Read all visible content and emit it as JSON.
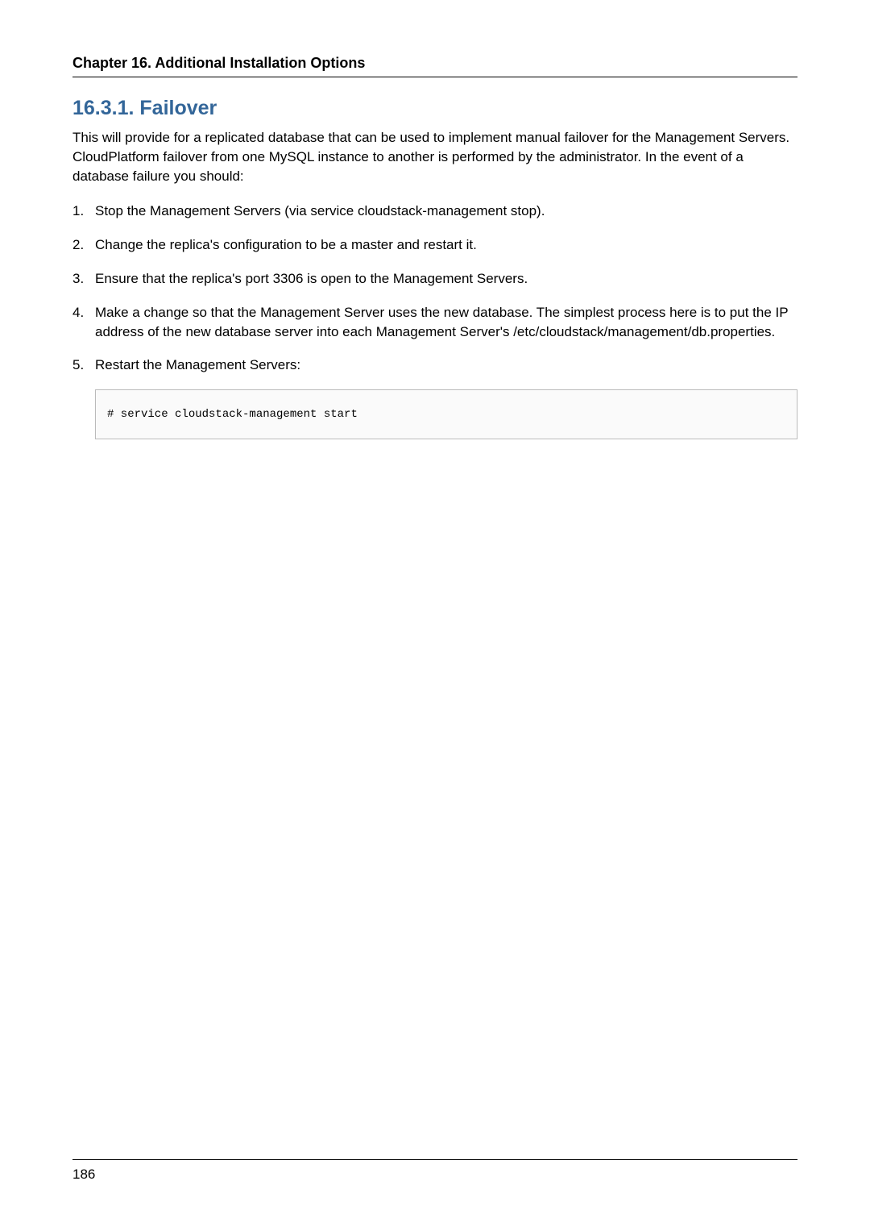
{
  "header": {
    "chapter_title": "Chapter 16. Additional Installation Options"
  },
  "section": {
    "heading": "16.3.1. Failover",
    "intro": "This will provide for a replicated database that can be used to implement manual failover for the Management Servers. CloudPlatform failover from one MySQL instance to another is performed by the administrator. In the event of a database failure you should:"
  },
  "steps": [
    {
      "num": "1.",
      "text": "Stop the Management Servers (via service cloudstack-management stop)."
    },
    {
      "num": "2.",
      "text": "Change the replica's configuration to be a master and restart it."
    },
    {
      "num": "3.",
      "text": "Ensure that the replica's port 3306 is open to the Management Servers."
    },
    {
      "num": "4.",
      "text": "Make a change so that the Management Server uses the new database. The simplest process here is to put the IP address of the new database server into each Management Server's /etc/cloudstack/management/db.properties."
    },
    {
      "num": "5.",
      "text": "Restart the Management Servers:"
    }
  ],
  "code": "# service cloudstack-management start",
  "footer": {
    "page_number": "186"
  }
}
